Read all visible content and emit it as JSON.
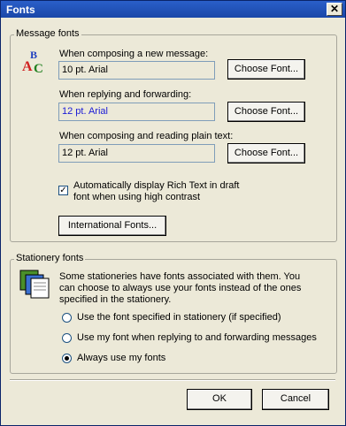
{
  "window": {
    "title": "Fonts",
    "close_label": "✕"
  },
  "message_fonts": {
    "group_label": "Message fonts",
    "new_message": {
      "label": "When composing a new message:",
      "value": "10 pt. Arial",
      "button": "Choose Font..."
    },
    "reply_forward": {
      "label": "When replying and forwarding:",
      "value": "12 pt. Arial",
      "button": "Choose Font..."
    },
    "plain_text": {
      "label": "When composing and reading plain text:",
      "value": "12 pt. Arial",
      "button": "Choose Font..."
    },
    "rich_text_checkbox": {
      "label_line1": "Automatically display Rich Text in draft",
      "label_line2": "font when using high contrast",
      "checked": true
    },
    "international_button": "International Fonts..."
  },
  "stationery_fonts": {
    "group_label": "Stationery fonts",
    "description_line1": "Some stationeries have fonts associated with them. You",
    "description_line2": "can choose to always use your fonts instead of the ones",
    "description_line3": "specified in the stationery.",
    "options": [
      {
        "label": "Use the font specified in stationery (if specified)",
        "selected": false
      },
      {
        "label": "Use my font when replying to and forwarding messages",
        "selected": false
      },
      {
        "label": "Always use my fonts",
        "selected": true
      }
    ]
  },
  "footer": {
    "ok": "OK",
    "cancel": "Cancel"
  }
}
